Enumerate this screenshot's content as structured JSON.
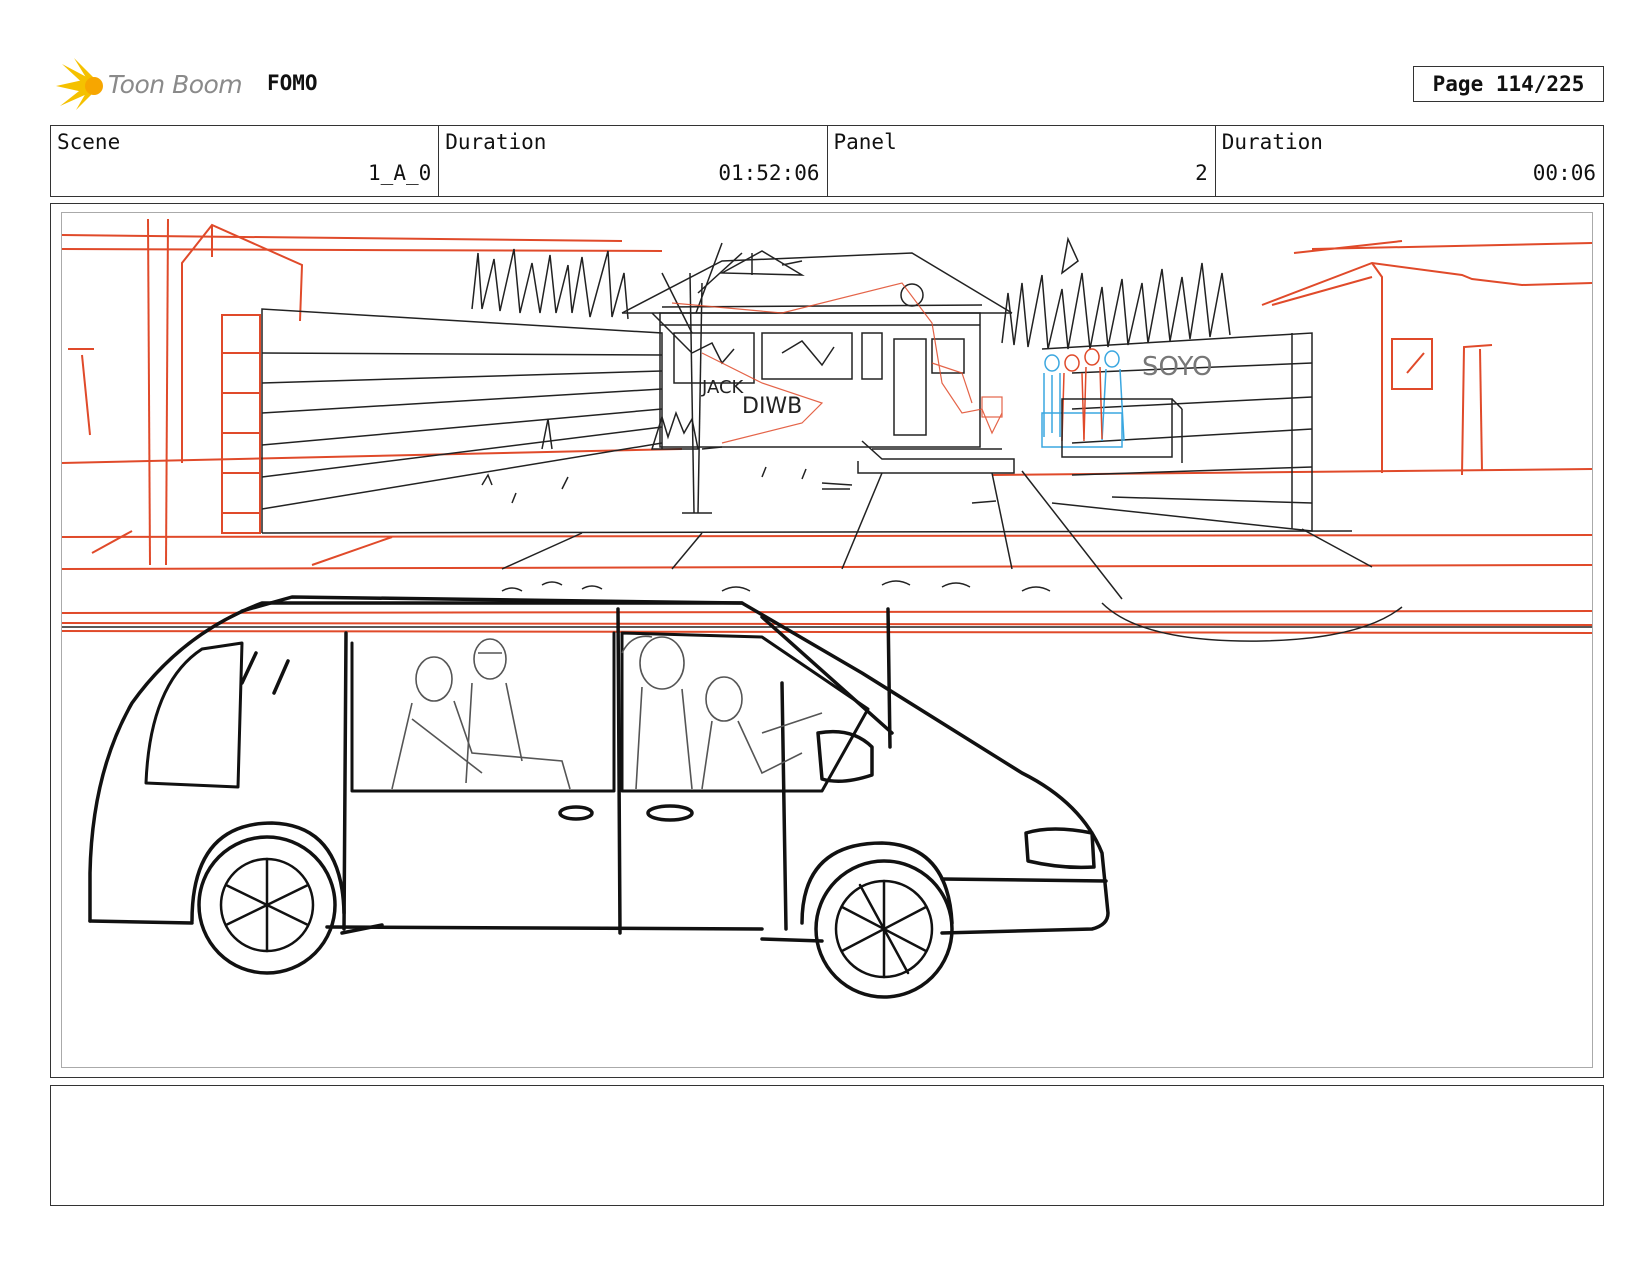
{
  "header": {
    "brand": "Toon Boom",
    "project": "FOMO",
    "page_label": "Page 114/225"
  },
  "info": {
    "cells": [
      {
        "label": "Scene",
        "value": "1_A_0"
      },
      {
        "label": "Duration",
        "value": "01:52:06"
      },
      {
        "label": "Panel",
        "value": "2"
      },
      {
        "label": "Duration",
        "value": "00:06"
      }
    ]
  },
  "sketch": {
    "graffiti": [
      "JACK",
      "DIWB",
      "SOYO"
    ],
    "colors": {
      "rough": "#e04a2a",
      "ink": "#111111",
      "figures_blue": "#3aa7e0",
      "figures_red": "#e04a2a"
    }
  },
  "notes": {
    "text": ""
  }
}
